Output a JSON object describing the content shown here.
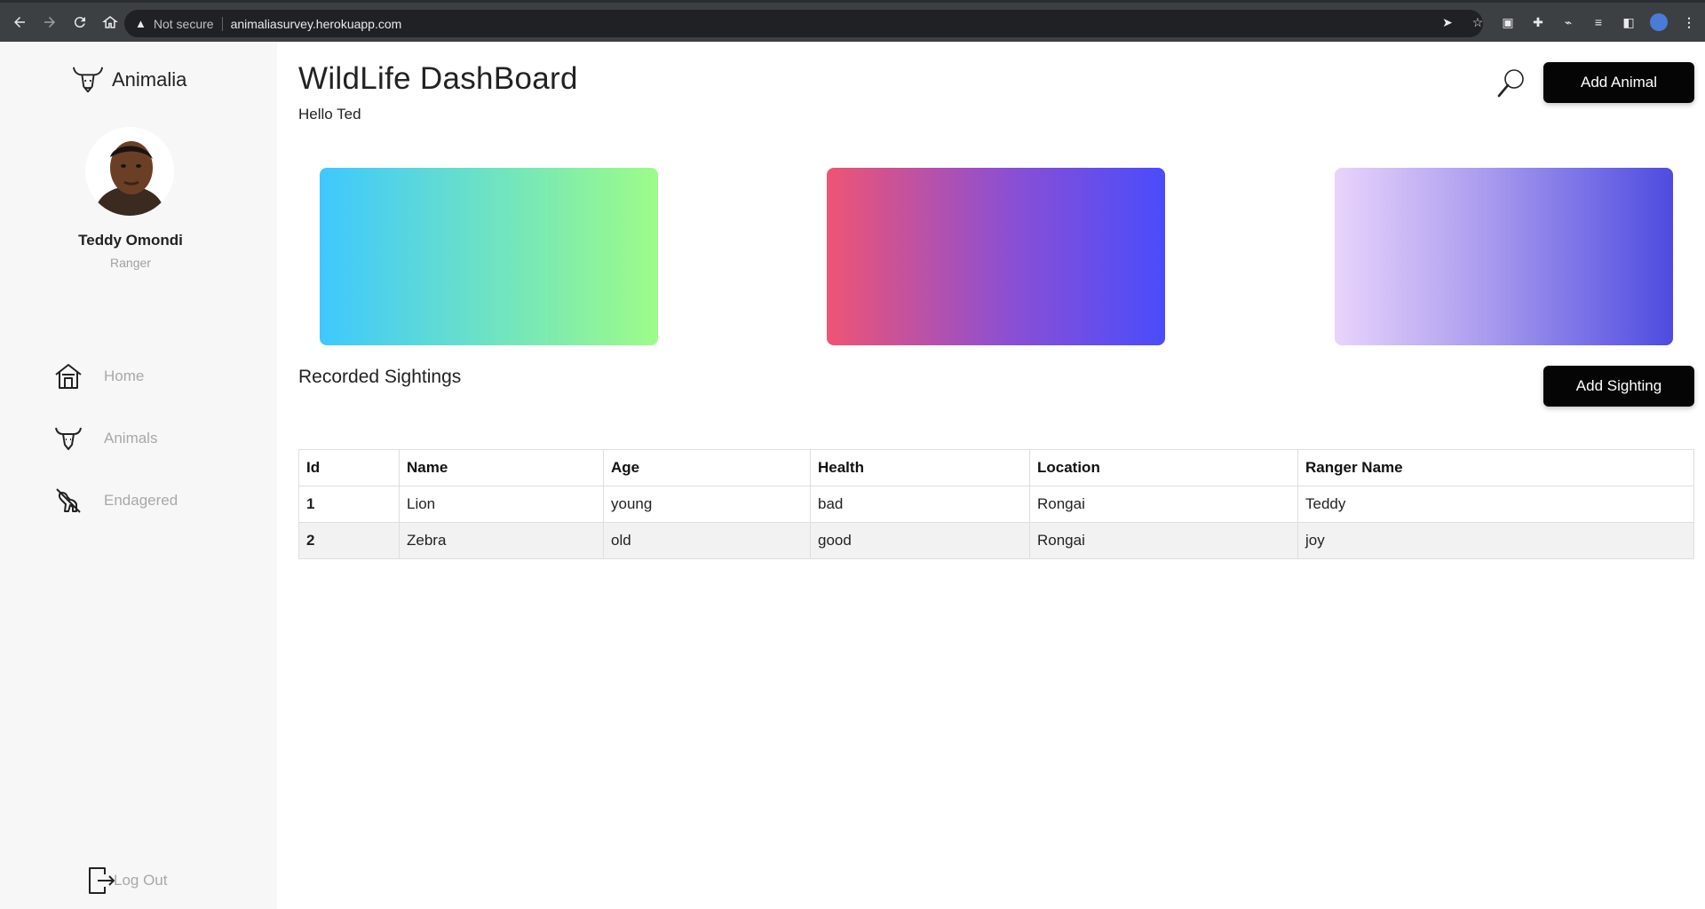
{
  "browser": {
    "security_label": "Not secure",
    "url": "animaliasurvey.herokuapp.com"
  },
  "sidebar": {
    "brand": "Animalia",
    "user": {
      "name": "Teddy Omondi",
      "role": "Ranger"
    },
    "items": [
      {
        "label": "Home",
        "icon": "home-icon"
      },
      {
        "label": "Animals",
        "icon": "animal-head-icon"
      },
      {
        "label": "Endagered",
        "icon": "endangered-icon"
      }
    ],
    "logout_label": "Log Out"
  },
  "header": {
    "title": "WildLife DashBoard",
    "greeting": "Hello Ted",
    "add_animal_label": "Add Animal"
  },
  "cards": [
    {
      "gradient": [
        "#3ec8ff",
        "#9dfc88"
      ]
    },
    {
      "gradient": [
        "#ef5474",
        "#4a4cfc"
      ]
    },
    {
      "gradient": [
        "#e9d4fc",
        "#4d4be0"
      ]
    }
  ],
  "sightings": {
    "title": "Recorded Sightings",
    "add_label": "Add Sighting",
    "columns": [
      "Id",
      "Name",
      "Age",
      "Health",
      "Location",
      "Ranger Name"
    ],
    "rows": [
      [
        "1",
        "Lion",
        "young",
        "bad",
        "Rongai",
        "Teddy"
      ],
      [
        "2",
        "Zebra",
        "old",
        "good",
        "Rongai",
        "joy"
      ]
    ]
  },
  "colors": {
    "button_bg": "#050505",
    "sidebar_bg": "#f7f7f7",
    "muted_text": "#a8a8a8"
  }
}
